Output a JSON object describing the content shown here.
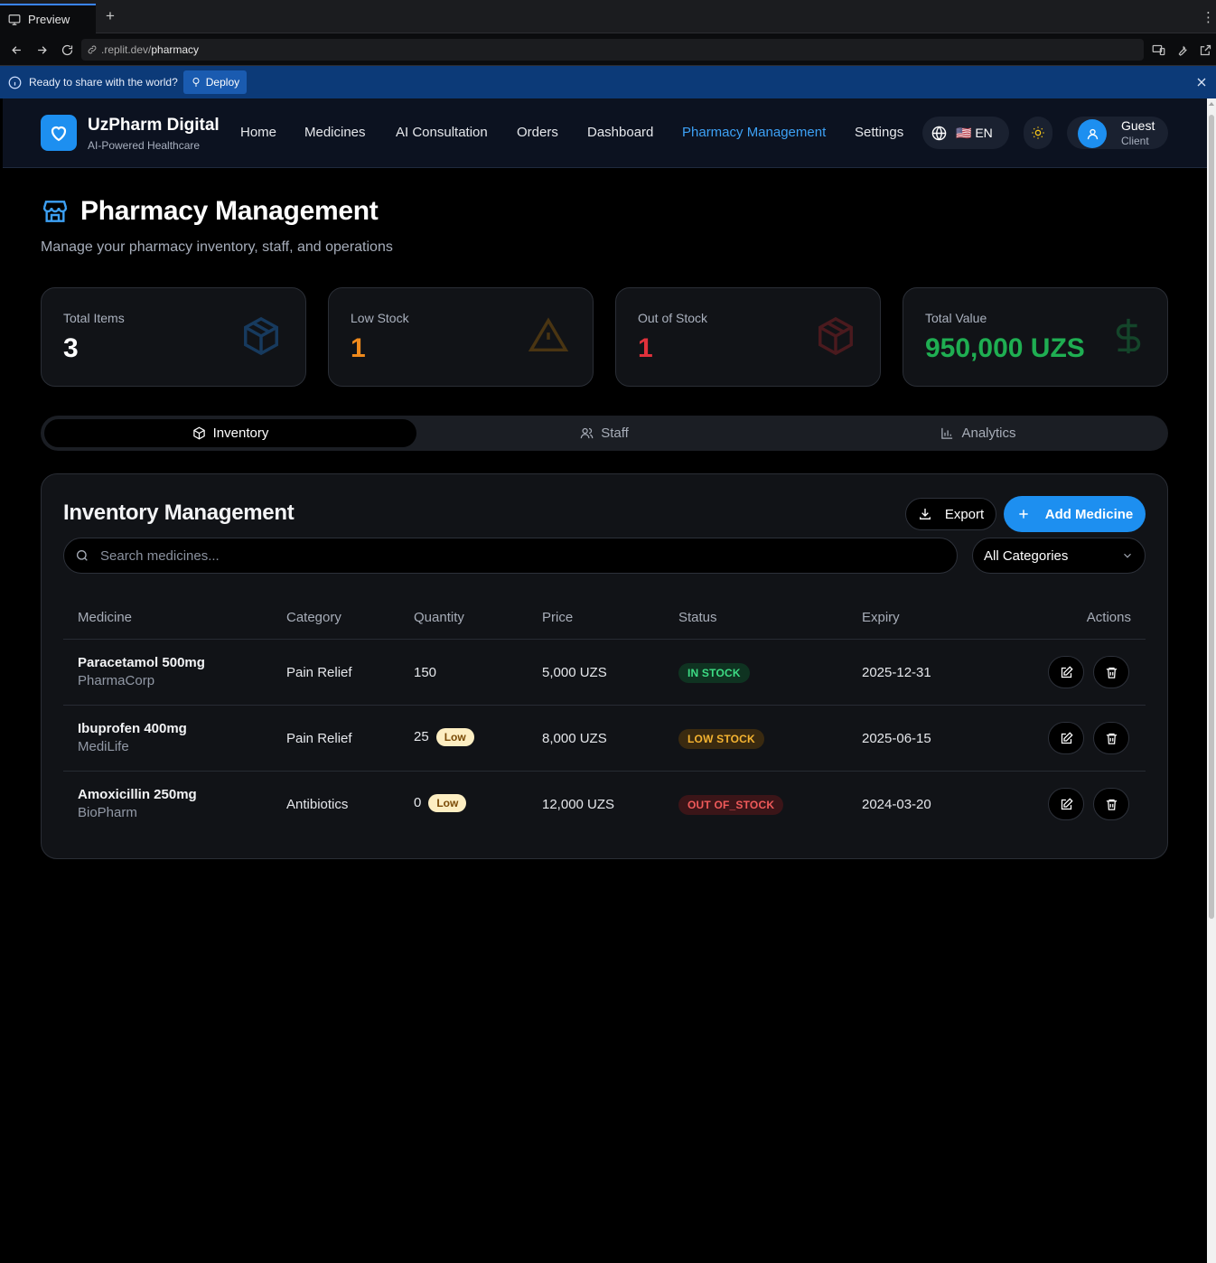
{
  "browser": {
    "tab_label": "Preview",
    "new_tab_label": "+",
    "url_prefix": ".replit.dev/",
    "url_path": "pharmacy",
    "banner_text": "Ready to share with the world?",
    "deploy_label": "Deploy"
  },
  "header": {
    "brand_title": "UzPharm Digital",
    "brand_subtitle": "AI-Powered Healthcare",
    "nav": [
      "Home",
      "Medicines",
      "AI Consultation",
      "Orders",
      "Dashboard",
      "Pharmacy Management",
      "Settings"
    ],
    "active_nav": "Pharmacy Management",
    "language": "🇺🇸 EN",
    "user_name": "Guest",
    "user_role": "Client"
  },
  "page": {
    "title": "Pharmacy Management",
    "subtitle": "Manage your pharmacy inventory, staff, and operations"
  },
  "stats": [
    {
      "label": "Total Items",
      "value": "3",
      "color": "#ffffff",
      "icon": "package-icon"
    },
    {
      "label": "Low Stock",
      "value": "1",
      "color": "#f08a1c",
      "icon": "alert-triangle-icon"
    },
    {
      "label": "Out of Stock",
      "value": "1",
      "color": "#e0313b",
      "icon": "package-icon"
    },
    {
      "label": "Total Value",
      "value": "950,000 UZS",
      "color": "#1fae52",
      "icon": "dollar-icon"
    }
  ],
  "tabs": [
    {
      "label": "Inventory",
      "icon": "package-icon",
      "active": true
    },
    {
      "label": "Staff",
      "icon": "users-icon",
      "active": false
    },
    {
      "label": "Analytics",
      "icon": "bar-chart-icon",
      "active": false
    }
  ],
  "inventory": {
    "title": "Inventory Management",
    "export_label": "Export",
    "add_label": "Add Medicine",
    "search_placeholder": "Search medicines...",
    "category_filter": "All Categories",
    "columns": [
      "Medicine",
      "Category",
      "Quantity",
      "Price",
      "Status",
      "Expiry",
      "Actions"
    ],
    "rows": [
      {
        "name": "Paracetamol 500mg",
        "maker": "PharmaCorp",
        "category": "Pain Relief",
        "quantity": "150",
        "low": "",
        "price": "5,000 UZS",
        "status": "IN STOCK",
        "status_color": "#3ddc84",
        "status_bg": "#0f3321",
        "expiry": "2025-12-31"
      },
      {
        "name": "Ibuprofen 400mg",
        "maker": "MediLife",
        "category": "Pain Relief",
        "quantity": "25",
        "low": "Low",
        "price": "8,000 UZS",
        "status": "LOW STOCK",
        "status_color": "#f5b431",
        "status_bg": "#3a2a10",
        "expiry": "2025-06-15"
      },
      {
        "name": "Amoxicillin 250mg",
        "maker": "BioPharm",
        "category": "Antibiotics",
        "quantity": "0",
        "low": "Low",
        "price": "12,000 UZS",
        "status": "OUT OF_STOCK",
        "status_color": "#f05a5a",
        "status_bg": "#3b1518",
        "expiry": "2024-03-20"
      }
    ]
  },
  "colors": {
    "accent": "#1d8ff0",
    "background": "#000000",
    "card": "#111317"
  }
}
